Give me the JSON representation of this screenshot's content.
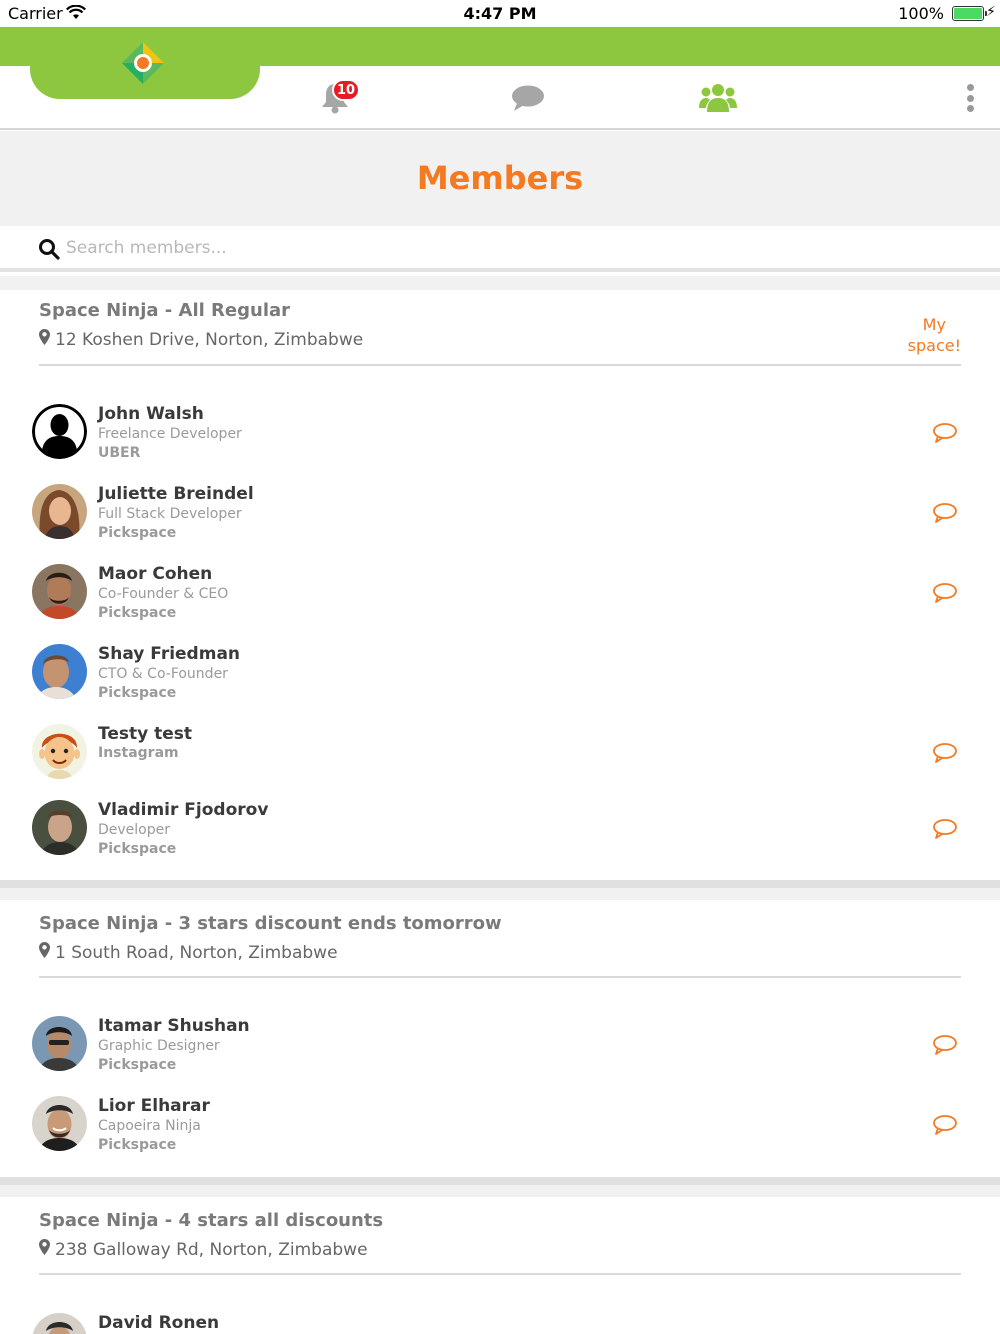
{
  "status_bar": {
    "carrier": "Carrier",
    "time": "4:47 PM",
    "battery": "100%"
  },
  "nav": {
    "notifications_badge": "10",
    "icons": [
      "logo-icon",
      "bell-icon",
      "chat-bubble-icon",
      "members-icon",
      "more-vertical-icon"
    ],
    "accent": "#8dc63f"
  },
  "page": {
    "title": "Members",
    "title_color": "#f37a20"
  },
  "search": {
    "placeholder": "Search members..."
  },
  "spaces": [
    {
      "name": "Space Ninja - All Regular",
      "address": "12 Koshen Drive, Norton, Zimbabwe",
      "my_space_line1": "My",
      "my_space_line2": "space!",
      "members": [
        {
          "name": "John Walsh",
          "role": "Freelance Developer",
          "company": "UBER"
        },
        {
          "name": "Juliette Breindel",
          "role": "Full Stack Developer",
          "company": "Pickspace"
        },
        {
          "name": "Maor Cohen",
          "role": "Co-Founder & CEO",
          "company": "Pickspace"
        },
        {
          "name": "Shay Friedman",
          "role": "CTO & Co-Founder",
          "company": "Pickspace"
        },
        {
          "name": "Testy test",
          "company": "Instagram"
        },
        {
          "name": "Vladimir Fjodorov",
          "role": "Developer",
          "company": "Pickspace"
        }
      ]
    },
    {
      "name": "Space Ninja - 3 stars discount ends tomorrow",
      "address": "1 South Road, Norton, Zimbabwe",
      "members": [
        {
          "name": "Itamar Shushan",
          "role": "Graphic Designer",
          "company": "Pickspace"
        },
        {
          "name": "Lior Elharar",
          "role": "Capoeira Ninja",
          "company": "Pickspace"
        }
      ]
    },
    {
      "name": "Space Ninja - 4 stars all discounts",
      "address": "238 Galloway Rd, Norton, Zimbabwe",
      "members": [
        {
          "name": "David Ronen"
        }
      ]
    }
  ]
}
